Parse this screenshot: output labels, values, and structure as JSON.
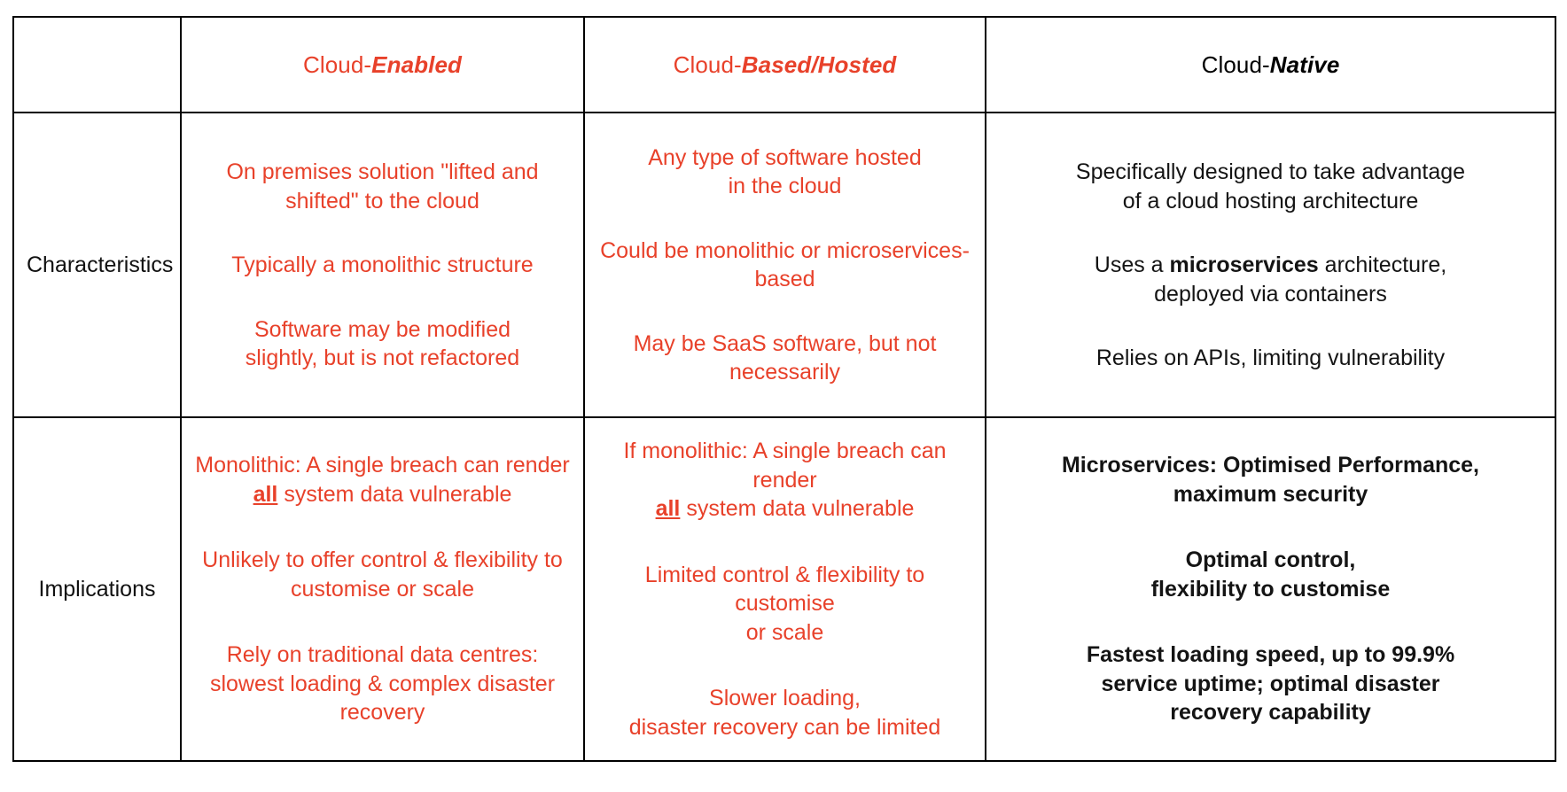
{
  "colors": {
    "red": "#E8412A",
    "black": "#000000",
    "border": "#000000",
    "background": "#FFFFFF"
  },
  "table": {
    "row_label_header": "",
    "columns": [
      {
        "key": "label",
        "prefix": "",
        "emphasis": "",
        "color": "#000000"
      },
      {
        "key": "enabled",
        "prefix": "Cloud-",
        "emphasis": "Enabled",
        "color": "#E8412A"
      },
      {
        "key": "based",
        "prefix": "Cloud-",
        "emphasis": "Based/Hosted",
        "color": "#E8412A"
      },
      {
        "key": "native",
        "prefix": "Cloud-",
        "emphasis": "Native",
        "color": "#000000"
      }
    ],
    "rows": [
      {
        "label": "Characteristics",
        "cells": {
          "enabled": {
            "color": "#E8412A",
            "paragraphs": [
              {
                "lines": [
                  "On premises solution \"lifted and",
                  "shifted\"  to the cloud"
                ]
              },
              {
                "lines": [
                  "Typically a monolithic structure"
                ]
              },
              {
                "lines": [
                  "Software may be modified",
                  "slightly, but is not refactored"
                ]
              }
            ]
          },
          "based": {
            "color": "#E8412A",
            "paragraphs": [
              {
                "lines": [
                  "Any type of software hosted",
                  "in the cloud"
                ]
              },
              {
                "lines": [
                  "Could be monolithic or microservices-",
                  "based"
                ]
              },
              {
                "lines": [
                  "May be SaaS software, but not",
                  "necessarily"
                ]
              }
            ]
          },
          "native": {
            "color": "#141414",
            "paragraphs": [
              {
                "lines": [
                  "Specifically designed to take advantage",
                  "of a cloud hosting architecture"
                ]
              },
              {
                "lines": [
                  "Uses a microservices architecture,",
                  "deployed via containers"
                ],
                "bold_words": [
                  "microservices"
                ]
              },
              {
                "lines": [
                  "Relies on APIs, limiting vulnerability"
                ]
              }
            ]
          }
        }
      },
      {
        "label": "Implications",
        "cells": {
          "enabled": {
            "color": "#E8412A",
            "paragraphs": [
              {
                "lines": [
                  "Monolithic: A single breach can render",
                  "all system data vulnerable"
                ],
                "bold_underline_words": [
                  "all"
                ]
              },
              {
                "lines": [
                  "Unlikely to offer control & flexibility to",
                  "customise or scale"
                ]
              },
              {
                "lines": [
                  "Rely on traditional data centres:",
                  "slowest loading & complex disaster",
                  "recovery"
                ]
              }
            ]
          },
          "based": {
            "color": "#E8412A",
            "paragraphs": [
              {
                "lines": [
                  "If monolithic: A single breach can render",
                  "all system data vulnerable"
                ],
                "bold_underline_words": [
                  "all"
                ]
              },
              {
                "lines": [
                  "Limited control & flexibility to customise",
                  "or scale"
                ]
              },
              {
                "lines": [
                  "Slower loading,",
                  "disaster recovery can be limited"
                ]
              }
            ]
          },
          "native": {
            "color": "#141414",
            "all_bold": true,
            "paragraphs": [
              {
                "lines": [
                  "Microservices: Optimised Performance,",
                  "maximum security"
                ]
              },
              {
                "lines": [
                  "Optimal control,",
                  "flexibility to customise"
                ]
              },
              {
                "lines": [
                  "Fastest loading speed, up to 99.9%",
                  "service uptime; optimal disaster",
                  "recovery capability"
                ]
              }
            ]
          }
        }
      }
    ]
  },
  "text": {
    "hdr_enabled_prefix": "Cloud-",
    "hdr_enabled_emph": "Enabled",
    "hdr_based_prefix": "Cloud-",
    "hdr_based_emph": "Based/Hosted",
    "hdr_native_prefix": "Cloud-",
    "hdr_native_emph": "Native",
    "label_characteristics": "Characteristics",
    "label_implications": "Implications",
    "char_enabled_p1_l1": "On premises solution \"lifted and",
    "char_enabled_p1_l2": "shifted\"  to the cloud",
    "char_enabled_p2_l1": "Typically a monolithic structure",
    "char_enabled_p3_l1": "Software may be modified",
    "char_enabled_p3_l2": "slightly, but is not refactored",
    "char_based_p1_l1": "Any type of software hosted",
    "char_based_p1_l2": "in the cloud",
    "char_based_p2_l1": "Could be monolithic or microservices-",
    "char_based_p2_l2": "based",
    "char_based_p3_l1": "May be SaaS software, but not",
    "char_based_p3_l2": "necessarily",
    "char_native_p1_l1": "Specifically designed to take advantage",
    "char_native_p1_l2": "of a cloud hosting architecture",
    "char_native_p2_a": "Uses a ",
    "char_native_p2_b": "microservices",
    "char_native_p2_c": " architecture,",
    "char_native_p2_l2": "deployed via containers",
    "char_native_p3_l1": "Relies on APIs, limiting vulnerability",
    "impl_enabled_p1_l1": "Monolithic: A single breach can render",
    "impl_enabled_p1_l2a": "all",
    "impl_enabled_p1_l2b": " system data vulnerable",
    "impl_enabled_p2_l1": "Unlikely to offer control & flexibility to",
    "impl_enabled_p2_l2": "customise or scale",
    "impl_enabled_p3_l1": "Rely on traditional data centres:",
    "impl_enabled_p3_l2": "slowest loading & complex disaster",
    "impl_enabled_p3_l3": "recovery",
    "impl_based_p1_l1": "If monolithic: A single breach can render",
    "impl_based_p1_l2a": "all",
    "impl_based_p1_l2b": " system data vulnerable",
    "impl_based_p2_l1": "Limited control & flexibility to customise",
    "impl_based_p2_l2": "or scale",
    "impl_based_p3_l1": "Slower loading,",
    "impl_based_p3_l2": "disaster recovery can be limited",
    "impl_native_p1_l1": "Microservices: Optimised Performance,",
    "impl_native_p1_l2": "maximum security",
    "impl_native_p2_l1": "Optimal control,",
    "impl_native_p2_l2": "flexibility to customise",
    "impl_native_p3_l1": "Fastest loading speed, up to 99.9%",
    "impl_native_p3_l2": "service uptime; optimal disaster",
    "impl_native_p3_l3": "recovery capability"
  }
}
